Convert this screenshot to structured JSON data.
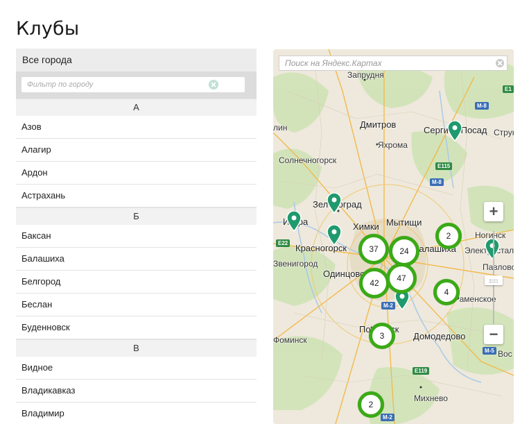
{
  "page": {
    "title": "Клубы"
  },
  "city_list": {
    "all_cities": "Все города",
    "filter_placeholder": "Фильтр по городу",
    "groups": [
      {
        "letter": "А",
        "cities": [
          "Азов",
          "Алагир",
          "Ардон",
          "Астрахань"
        ]
      },
      {
        "letter": "Б",
        "cities": [
          "Баксан",
          "Балашиха",
          "Белгород",
          "Беслан",
          "Буденновск"
        ]
      },
      {
        "letter": "В",
        "cities": [
          "Видное",
          "Владикавказ",
          "Владимир"
        ]
      }
    ]
  },
  "map": {
    "search_placeholder": "Поиск на Яндекс.Картах",
    "zoom_in": "+",
    "zoom_out": "−",
    "labels": {
      "zaprudnya": "Запрудня",
      "dmitrov": "Дмитров",
      "yakhroma": "Яхрома",
      "sergiev_posad": "Сергиев Посад",
      "strun": "Струн",
      "klin": "лин",
      "solnechnogorsk": "Солнечногорск",
      "zelenograd": "Зеленоград",
      "istra": "Истра",
      "khimki": "Химки",
      "mytishchi": "Мытищи",
      "krasnogorsk": "Красногорск",
      "balashikha": "Балашиха",
      "noginsk": "Ногинск",
      "elektrostal": "Электросталь",
      "zvenigorod": "Звенигород",
      "odintsovo": "Одинцово",
      "pavlovo": "Павлово",
      "ramenskoe": "Раменское",
      "podolsk": "Подольск",
      "domodedovo": "Домодедово",
      "fominsk": "Фоминск",
      "voskresensk": "Вос",
      "mikhnevo": "Михнево"
    },
    "roads": {
      "e115": "E115",
      "m8a": "M-8",
      "m8b": "M-8",
      "e22": "E22",
      "m2": "M-2",
      "m5": "M-5",
      "e119": "E119",
      "m2b": "M-2",
      "e1": "E1"
    },
    "clusters": [
      {
        "count": "37"
      },
      {
        "count": "24"
      },
      {
        "count": "42"
      },
      {
        "count": "47"
      },
      {
        "count": "2"
      },
      {
        "count": "4"
      },
      {
        "count": "3"
      },
      {
        "count": "2"
      }
    ],
    "colors": {
      "cluster_ring": "#3aaa16",
      "pin": "#1f9a6e"
    }
  }
}
